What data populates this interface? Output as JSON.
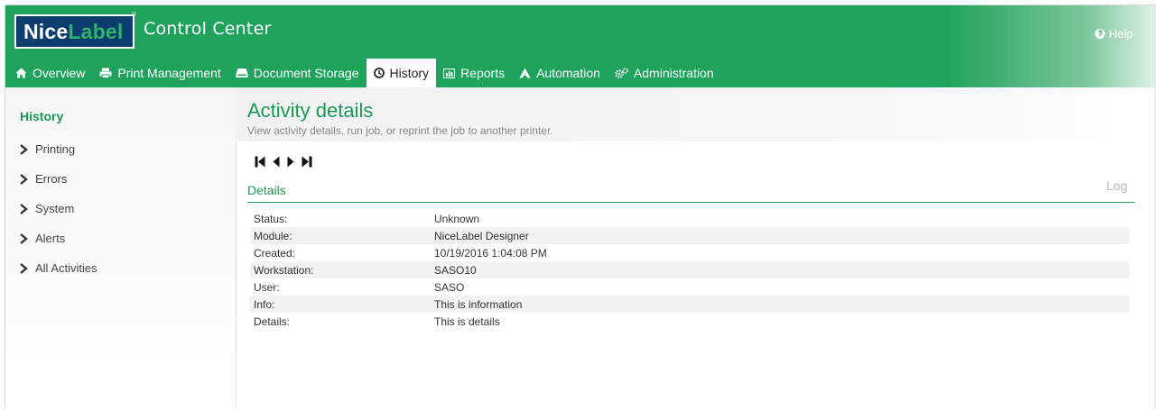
{
  "header": {
    "logo_part1": "Nice",
    "logo_part2": "Label",
    "logo_tm": "®",
    "app_title": "Control Center",
    "help_label": "Help"
  },
  "tabs": [
    {
      "label": "Overview",
      "icon": "home-icon"
    },
    {
      "label": "Print Management",
      "icon": "printer-icon"
    },
    {
      "label": "Document Storage",
      "icon": "storage-icon"
    },
    {
      "label": "History",
      "icon": "clock-icon",
      "active": true
    },
    {
      "label": "Reports",
      "icon": "chart-icon"
    },
    {
      "label": "Automation",
      "icon": "automation-icon"
    },
    {
      "label": "Administration",
      "icon": "gears-icon"
    }
  ],
  "sidebar": {
    "title": "History",
    "items": [
      {
        "label": "Printing"
      },
      {
        "label": "Errors"
      },
      {
        "label": "System"
      },
      {
        "label": "Alerts"
      },
      {
        "label": "All Activities"
      }
    ]
  },
  "main": {
    "title": "Activity details",
    "subtitle": "View activity details, run job, or reprint the job to another printer.",
    "section_title": "Details",
    "log_label": "Log",
    "details": [
      {
        "key": "Status:",
        "value": "Unknown"
      },
      {
        "key": "Module:",
        "value": "NiceLabel Designer"
      },
      {
        "key": "Created:",
        "value": "10/19/2016 1:04:08 PM"
      },
      {
        "key": "Workstation:",
        "value": "SASO10"
      },
      {
        "key": "User:",
        "value": "SASO"
      },
      {
        "key": "Info:",
        "value": "This is information"
      },
      {
        "key": "Details:",
        "value": "This is details"
      }
    ]
  },
  "colors": {
    "brand_green": "#1fa35c",
    "accent_text_green": "#1a9a55",
    "logo_navy": "#0b3d6e"
  }
}
